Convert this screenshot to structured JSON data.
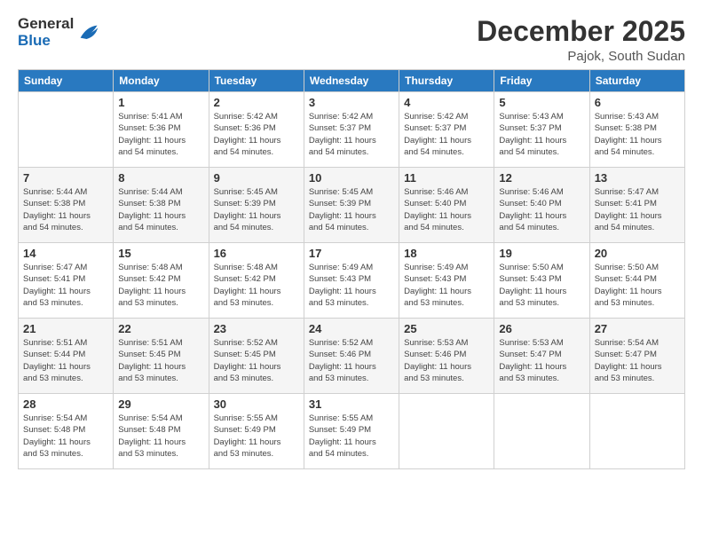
{
  "logo": {
    "general": "General",
    "blue": "Blue"
  },
  "header": {
    "month": "December 2025",
    "location": "Pajok, South Sudan"
  },
  "weekdays": [
    "Sunday",
    "Monday",
    "Tuesday",
    "Wednesday",
    "Thursday",
    "Friday",
    "Saturday"
  ],
  "weeks": [
    [
      {
        "day": null,
        "info": null
      },
      {
        "day": "1",
        "info": "Sunrise: 5:41 AM\nSunset: 5:36 PM\nDaylight: 11 hours\nand 54 minutes."
      },
      {
        "day": "2",
        "info": "Sunrise: 5:42 AM\nSunset: 5:36 PM\nDaylight: 11 hours\nand 54 minutes."
      },
      {
        "day": "3",
        "info": "Sunrise: 5:42 AM\nSunset: 5:37 PM\nDaylight: 11 hours\nand 54 minutes."
      },
      {
        "day": "4",
        "info": "Sunrise: 5:42 AM\nSunset: 5:37 PM\nDaylight: 11 hours\nand 54 minutes."
      },
      {
        "day": "5",
        "info": "Sunrise: 5:43 AM\nSunset: 5:37 PM\nDaylight: 11 hours\nand 54 minutes."
      },
      {
        "day": "6",
        "info": "Sunrise: 5:43 AM\nSunset: 5:38 PM\nDaylight: 11 hours\nand 54 minutes."
      }
    ],
    [
      {
        "day": "7",
        "info": "Sunrise: 5:44 AM\nSunset: 5:38 PM\nDaylight: 11 hours\nand 54 minutes."
      },
      {
        "day": "8",
        "info": "Sunrise: 5:44 AM\nSunset: 5:38 PM\nDaylight: 11 hours\nand 54 minutes."
      },
      {
        "day": "9",
        "info": "Sunrise: 5:45 AM\nSunset: 5:39 PM\nDaylight: 11 hours\nand 54 minutes."
      },
      {
        "day": "10",
        "info": "Sunrise: 5:45 AM\nSunset: 5:39 PM\nDaylight: 11 hours\nand 54 minutes."
      },
      {
        "day": "11",
        "info": "Sunrise: 5:46 AM\nSunset: 5:40 PM\nDaylight: 11 hours\nand 54 minutes."
      },
      {
        "day": "12",
        "info": "Sunrise: 5:46 AM\nSunset: 5:40 PM\nDaylight: 11 hours\nand 54 minutes."
      },
      {
        "day": "13",
        "info": "Sunrise: 5:47 AM\nSunset: 5:41 PM\nDaylight: 11 hours\nand 54 minutes."
      }
    ],
    [
      {
        "day": "14",
        "info": "Sunrise: 5:47 AM\nSunset: 5:41 PM\nDaylight: 11 hours\nand 53 minutes."
      },
      {
        "day": "15",
        "info": "Sunrise: 5:48 AM\nSunset: 5:42 PM\nDaylight: 11 hours\nand 53 minutes."
      },
      {
        "day": "16",
        "info": "Sunrise: 5:48 AM\nSunset: 5:42 PM\nDaylight: 11 hours\nand 53 minutes."
      },
      {
        "day": "17",
        "info": "Sunrise: 5:49 AM\nSunset: 5:43 PM\nDaylight: 11 hours\nand 53 minutes."
      },
      {
        "day": "18",
        "info": "Sunrise: 5:49 AM\nSunset: 5:43 PM\nDaylight: 11 hours\nand 53 minutes."
      },
      {
        "day": "19",
        "info": "Sunrise: 5:50 AM\nSunset: 5:43 PM\nDaylight: 11 hours\nand 53 minutes."
      },
      {
        "day": "20",
        "info": "Sunrise: 5:50 AM\nSunset: 5:44 PM\nDaylight: 11 hours\nand 53 minutes."
      }
    ],
    [
      {
        "day": "21",
        "info": "Sunrise: 5:51 AM\nSunset: 5:44 PM\nDaylight: 11 hours\nand 53 minutes."
      },
      {
        "day": "22",
        "info": "Sunrise: 5:51 AM\nSunset: 5:45 PM\nDaylight: 11 hours\nand 53 minutes."
      },
      {
        "day": "23",
        "info": "Sunrise: 5:52 AM\nSunset: 5:45 PM\nDaylight: 11 hours\nand 53 minutes."
      },
      {
        "day": "24",
        "info": "Sunrise: 5:52 AM\nSunset: 5:46 PM\nDaylight: 11 hours\nand 53 minutes."
      },
      {
        "day": "25",
        "info": "Sunrise: 5:53 AM\nSunset: 5:46 PM\nDaylight: 11 hours\nand 53 minutes."
      },
      {
        "day": "26",
        "info": "Sunrise: 5:53 AM\nSunset: 5:47 PM\nDaylight: 11 hours\nand 53 minutes."
      },
      {
        "day": "27",
        "info": "Sunrise: 5:54 AM\nSunset: 5:47 PM\nDaylight: 11 hours\nand 53 minutes."
      }
    ],
    [
      {
        "day": "28",
        "info": "Sunrise: 5:54 AM\nSunset: 5:48 PM\nDaylight: 11 hours\nand 53 minutes."
      },
      {
        "day": "29",
        "info": "Sunrise: 5:54 AM\nSunset: 5:48 PM\nDaylight: 11 hours\nand 53 minutes."
      },
      {
        "day": "30",
        "info": "Sunrise: 5:55 AM\nSunset: 5:49 PM\nDaylight: 11 hours\nand 53 minutes."
      },
      {
        "day": "31",
        "info": "Sunrise: 5:55 AM\nSunset: 5:49 PM\nDaylight: 11 hours\nand 54 minutes."
      },
      {
        "day": null,
        "info": null
      },
      {
        "day": null,
        "info": null
      },
      {
        "day": null,
        "info": null
      }
    ]
  ]
}
